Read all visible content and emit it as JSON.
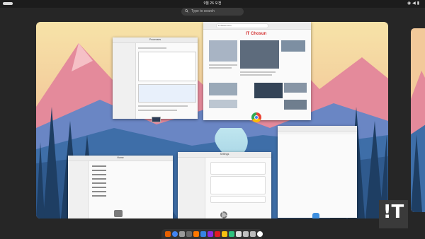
{
  "topbar": {
    "clock": "9월 26 오전",
    "status_icons": [
      "network-icon",
      "volume-icon",
      "battery-icon"
    ]
  },
  "search": {
    "placeholder": "Type to search"
  },
  "windows": {
    "system_monitor": {
      "title": "Processes"
    },
    "browser": {
      "title": "IT Chosun",
      "logo": "IT Chosun",
      "address": "it.chosun.com"
    },
    "text_editor": {
      "title": ""
    },
    "files": {
      "title": "Home"
    },
    "settings": {
      "title": "Settings"
    }
  },
  "dock": {
    "apps": [
      {
        "name": "firefox-icon",
        "color": "#e66000"
      },
      {
        "name": "chrome-icon",
        "color": "#4285f4"
      },
      {
        "name": "app-grid-icon",
        "color": "#9a9a9a"
      },
      {
        "name": "files-icon",
        "color": "#6a6a6a"
      },
      {
        "name": "software-icon",
        "color": "#ff7800"
      },
      {
        "name": "calendar-icon",
        "color": "#3584e4"
      },
      {
        "name": "terminal-icon",
        "color": "#8a2be2"
      },
      {
        "name": "music-icon",
        "color": "#e01b24"
      },
      {
        "name": "photos-icon",
        "color": "#f5c211"
      },
      {
        "name": "monitor-icon",
        "color": "#2ec27e"
      },
      {
        "name": "help-icon",
        "color": "#dddddd"
      },
      {
        "name": "settings-icon",
        "color": "#c0c0c0"
      },
      {
        "name": "trash-icon",
        "color": "#bbbbbb"
      },
      {
        "name": "show-apps-icon",
        "color": "#ffffff"
      }
    ]
  },
  "logo": {
    "text": "!T"
  }
}
